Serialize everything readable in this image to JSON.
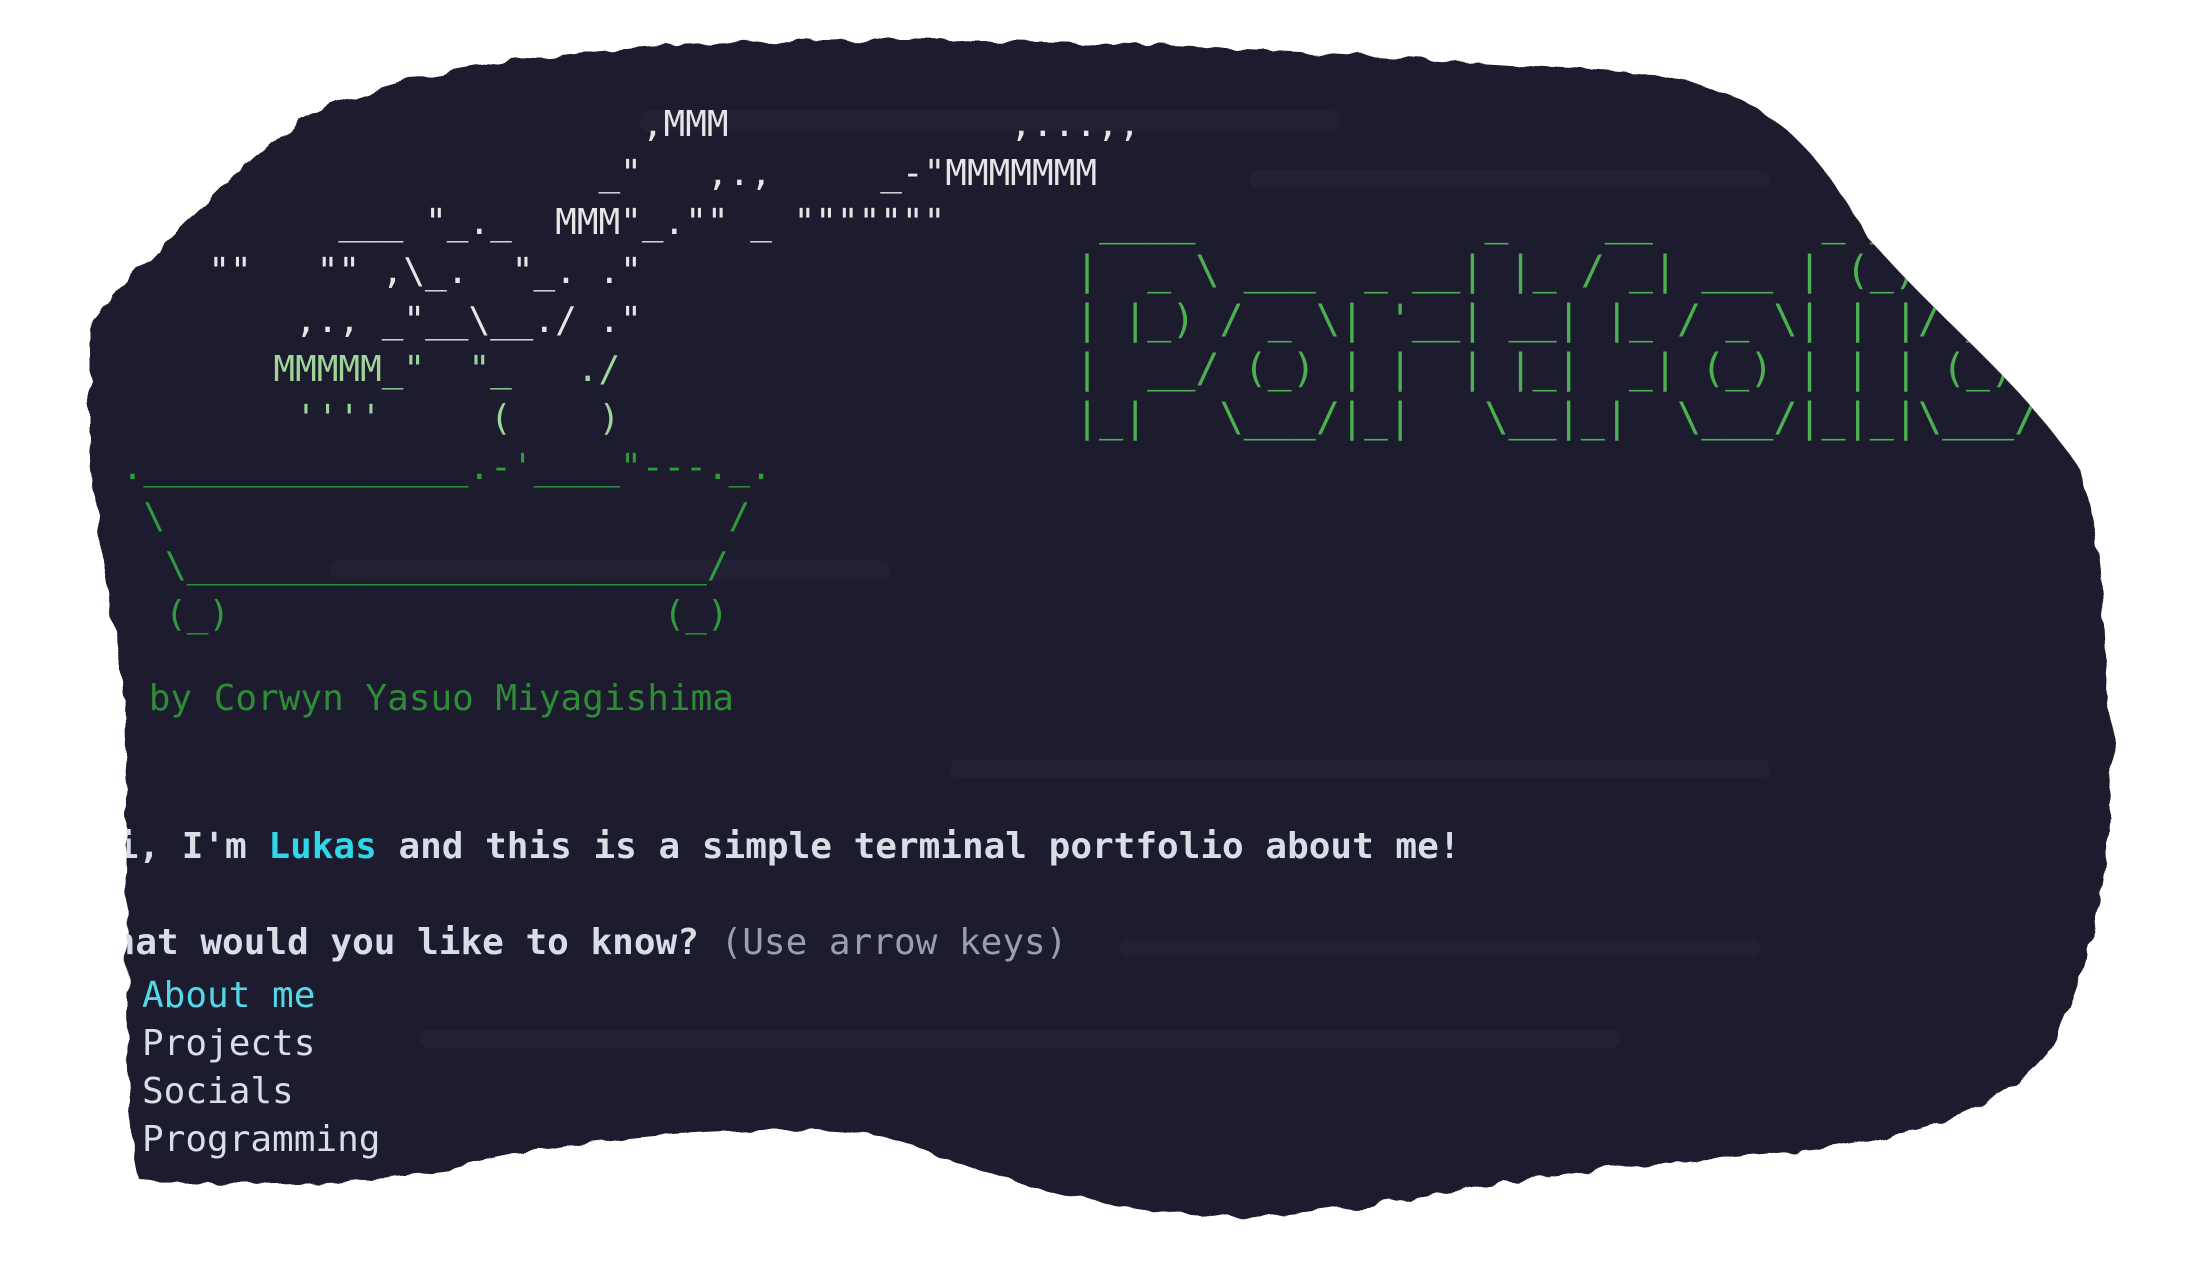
{
  "ascii_art": {
    "bonsai_lines": [
      "                         ,MMM             ,...,,",
      "                       _\"   ,.,     _-\"MMMMMMM",
      "           ___ \"_._  MMM\"_.\"\" _ \"\"\"\"\"\"\"",
      "     \"\"   \"\" ,\\_.  \"_. .\"",
      "         ,., _\"__\\__./ .\"",
      "        MMMMM_\"  \"_   ./",
      "         ''''     (    )",
      " ._______________.-'____\"---._.",
      "  \\                          /",
      "   \\________________________/",
      "   (_)                    (_)"
    ],
    "portfolio_banner": " ____            _    __       _ _\n|  _ \\ ___  _ __| |_ / _| ___ | (_) ___\n| |_) / _ \\| '__| __| |_ / _ \\| | |/ _ \\\n|  __/ (_) | |  | |_|  _| (_) | | | (_) |\n|_|   \\___/|_|   \\__|_|  \\___/|_|_|\\___/",
    "credit": "Art by Corwyn Yasuo Miyagishima"
  },
  "intro": {
    "prefix": "Hi, I'm ",
    "name": "Lukas",
    "suffix": " and this is a simple terminal portfolio about me!"
  },
  "prompt": {
    "question": "What would you like to know?",
    "hint": "(Use arrow keys)"
  },
  "menu": {
    "cursor": "❯",
    "options": [
      "About me",
      "Projects",
      "Socials",
      "Programming"
    ],
    "selected_index": 0
  },
  "colors": {
    "terminal_bg": "#1e1e2e",
    "accent_cyan": "#2fd8e8",
    "green": "#4caf50"
  }
}
